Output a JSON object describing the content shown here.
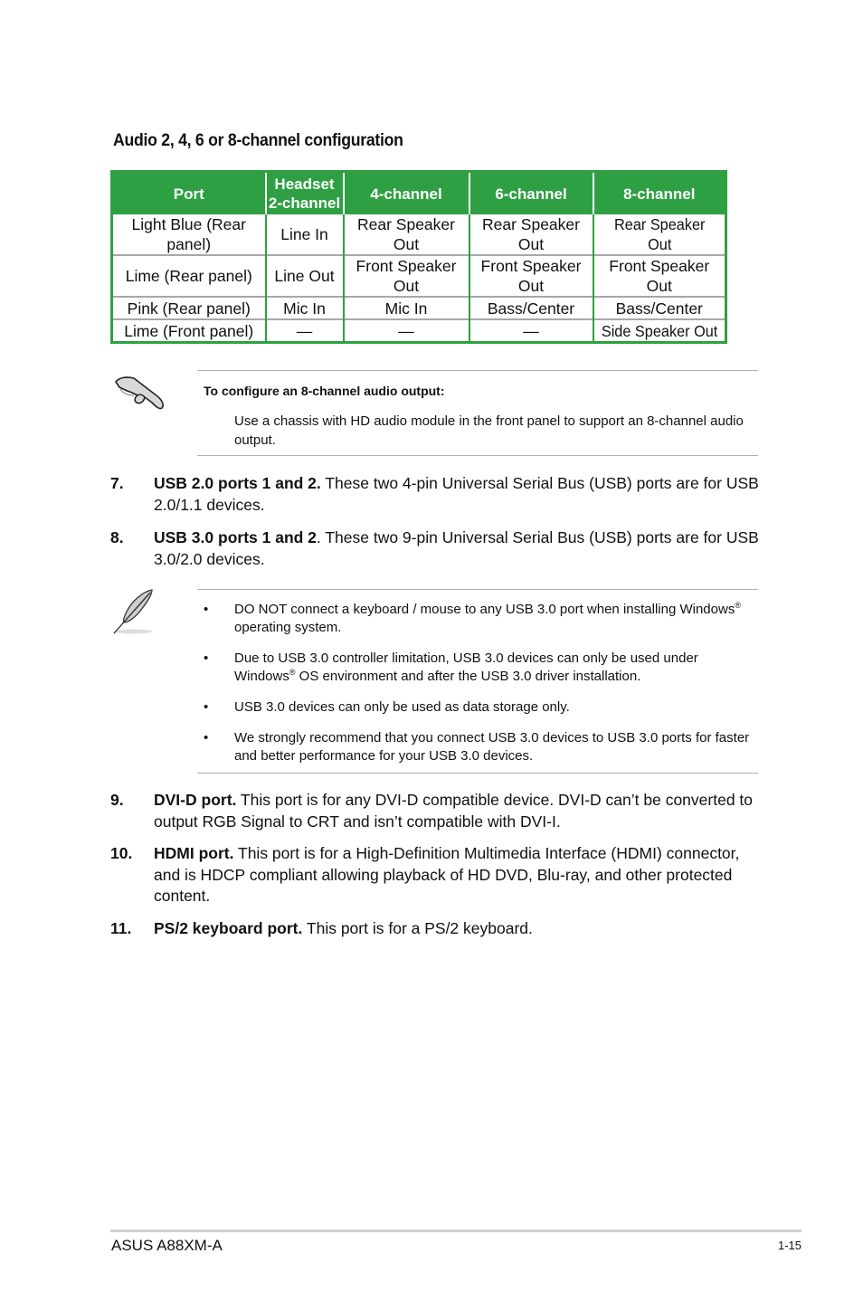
{
  "section_title": "Audio 2, 4, 6 or 8-channel configuration",
  "audio_table": {
    "headers": [
      "Port",
      "Headset 2-channel",
      "4-channel",
      "6-channel",
      "8-channel"
    ],
    "header_lines": {
      "headset_1": "Headset",
      "headset_2": "2-channel"
    },
    "rows": [
      [
        "Light Blue (Rear panel)",
        "Line In",
        "Rear Speaker Out",
        "Rear Speaker Out",
        "Rear Speaker Out"
      ],
      [
        "Lime (Rear panel)",
        "Line Out",
        "Front Speaker Out",
        "Front Speaker Out",
        "Front Speaker Out"
      ],
      [
        "Pink (Rear panel)",
        "Mic In",
        "Mic In",
        "Bass/Center",
        "Bass/Center"
      ],
      [
        "Lime (Front panel)",
        "—",
        "—",
        "—",
        "Side Speaker Out"
      ]
    ],
    "colors": {
      "header_bg": "#2ea043",
      "header_text": "#ffffff",
      "row_divider": "#a8a8a8"
    }
  },
  "note_important": {
    "icon": "pointing-hand-icon",
    "heading": "To configure an 8-channel audio output:",
    "body": "Use a chassis with HD audio module in the front panel to support an 8-channel audio output."
  },
  "items_a": [
    {
      "number": "7.",
      "title": "USB 2.0 ports 1 and 2.",
      "text": " These two 4-pin Universal Serial Bus (USB) ports are for USB 2.0/1.1 devices."
    },
    {
      "number": "8.",
      "title": "USB 3.0 ports 1 and 2",
      "text": ". These two 9-pin Universal Serial Bus (USB) ports are for USB 3.0/2.0 devices."
    }
  ],
  "note_usb": {
    "icon": "feather-quill-icon",
    "bullets": [
      {
        "a": "DO NOT connect a keyboard / mouse to any USB 3.0 port when installing Windows",
        "sup": "®",
        "b": " operating system."
      },
      {
        "a": "Due to USB 3.0 controller limitation, USB 3.0 devices can only be used under Windows",
        "sup": "®",
        "b": " OS environment and after the USB 3.0 driver installation."
      },
      {
        "a": "USB 3.0 devices can only be used as data storage only.",
        "sup": "",
        "b": ""
      },
      {
        "a": "We strongly recommend that you connect USB 3.0 devices to USB 3.0 ports for faster and better performance for your USB 3.0 devices.",
        "sup": "",
        "b": ""
      }
    ],
    "bullet_glyph": "•"
  },
  "items_b": [
    {
      "number": "9.",
      "title": "DVI-D port.",
      "text": " This port is for any DVI-D compatible device. DVI-D can’t be converted to output RGB Signal to CRT and isn’t compatible with DVI-I."
    },
    {
      "number": "10.",
      "title": "HDMI port.",
      "text": " This port is for a High-Definition Multimedia Interface (HDMI) connector, and is HDCP compliant allowing playback of HD DVD, Blu-ray, and other protected content."
    },
    {
      "number": "11.",
      "title": "PS/2 keyboard port.",
      "text": " This port is for a PS/2 keyboard."
    }
  ],
  "footer": {
    "product": "ASUS A88XM-A",
    "page": "1-15"
  }
}
